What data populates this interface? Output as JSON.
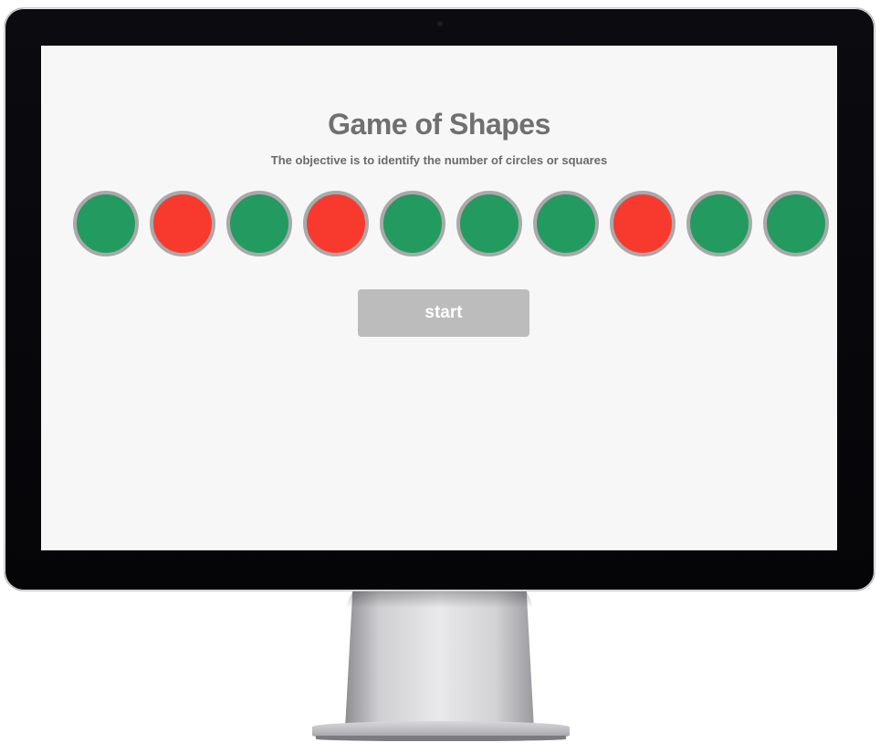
{
  "game": {
    "title": "Game of Shapes",
    "subtitle": "The objective is to identify the number of circles or squares",
    "start_label": "start"
  },
  "shapes": [
    {
      "shape": "circle",
      "color": "green"
    },
    {
      "shape": "circle",
      "color": "red"
    },
    {
      "shape": "circle",
      "color": "green"
    },
    {
      "shape": "circle",
      "color": "red"
    },
    {
      "shape": "circle",
      "color": "green"
    },
    {
      "shape": "circle",
      "color": "green"
    },
    {
      "shape": "circle",
      "color": "green"
    },
    {
      "shape": "circle",
      "color": "red"
    },
    {
      "shape": "circle",
      "color": "green"
    },
    {
      "shape": "circle",
      "color": "green"
    }
  ],
  "colors": {
    "green": "#239a5f",
    "red": "#f73a2d",
    "shape_border": "#a9a9a9",
    "button_bg": "#bcbcbc",
    "screen_bg": "#f7f7f7"
  }
}
